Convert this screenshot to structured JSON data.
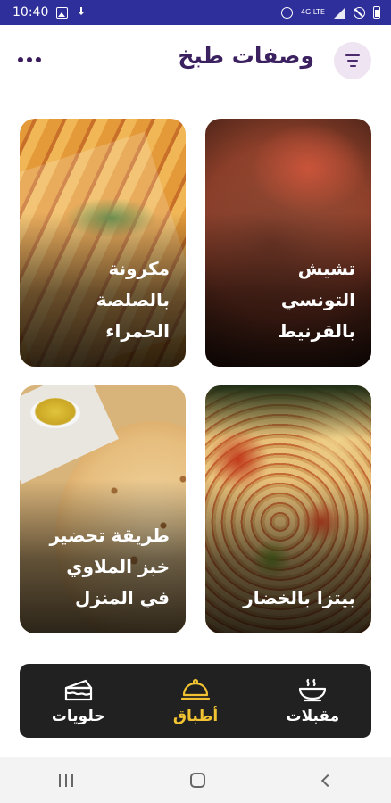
{
  "status_bar": {
    "time": "10:40",
    "lte_label": "4G LTE"
  },
  "header": {
    "title": "وصفات طبخ",
    "menu_icon": "more-dots-icon",
    "filter_icon": "filter-icon"
  },
  "recipes": [
    {
      "title": "تشيش التونسي بالقرنيط"
    },
    {
      "title": "مكرونة بالصلصة الحمراء"
    },
    {
      "title": "بيتزا بالخضار"
    },
    {
      "title": "طريقة تحضير خبز الملاوي في المنزل"
    }
  ],
  "bottom_nav": {
    "items": [
      {
        "label": "مقبلات",
        "icon": "soup-bowl-icon",
        "active": false
      },
      {
        "label": "أطباق",
        "icon": "cloche-icon",
        "active": true
      },
      {
        "label": "حلويات",
        "icon": "cake-icon",
        "active": false
      }
    ],
    "active_color": "#f1c232",
    "background_color": "#212121"
  },
  "colors": {
    "status_bar": "#2e2f9a",
    "title": "#3b2160",
    "filter_button_bg": "#efe4f1"
  }
}
